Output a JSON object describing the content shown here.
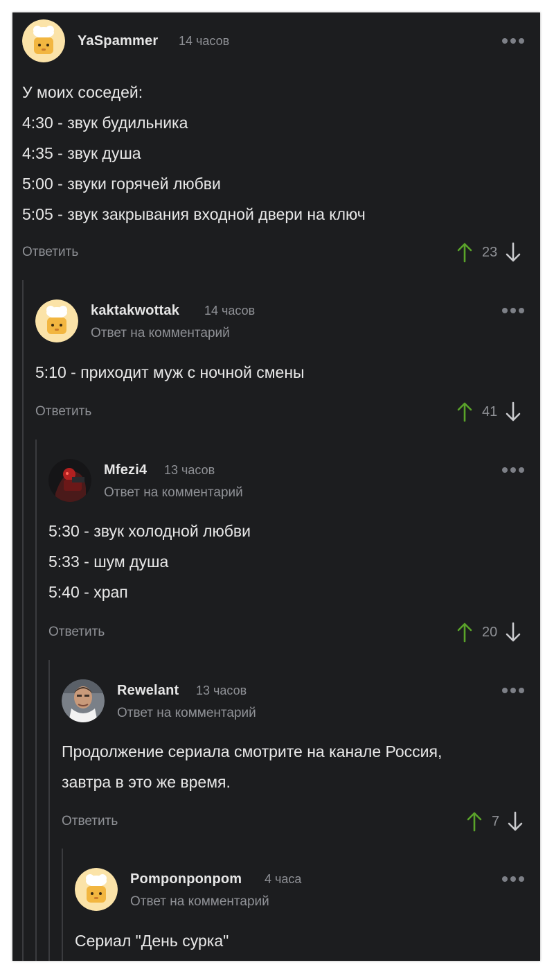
{
  "comments": [
    {
      "user": "YaSpammer",
      "time": "14 часов",
      "reply_to": "",
      "text": "У моих соседей:\n4:30 - звук будильника\n4:35 - звук душа\n5:00 - звуки горячей любви\n5:05 - звук закрывания входной двери на ключ",
      "reply_label": "Ответить",
      "rating": "23",
      "avatar": "chef-hat-cat-avatar"
    },
    {
      "user": "kaktakwottak",
      "time": "14 часов",
      "reply_to": "Ответ на комментарий",
      "text": "5:10 - приходит муж с ночной смены",
      "reply_label": "Ответить",
      "rating": "41",
      "avatar": "chef-hat-cat-avatar"
    },
    {
      "user": "Mfezi4",
      "time": "13 часов",
      "reply_to": "Ответ на комментарий",
      "text": "5:30 - звук холодной любви\n5:33 - шум душа\n5:40 - храп",
      "reply_label": "Ответить",
      "rating": "20",
      "avatar": "dark-red-figure-avatar"
    },
    {
      "user": "Rewelant",
      "time": "13 часов",
      "reply_to": "Ответ на комментарий",
      "text": "Продолжение сериала смотрите на канале Россия,\nзавтра в это же время.",
      "reply_label": "Ответить",
      "rating": "7",
      "avatar": "man-photo-avatar"
    },
    {
      "user": "Pomponponpom",
      "time": "4 часа",
      "reply_to": "Ответ на комментарий",
      "text": "Сериал \"День сурка\"",
      "avatar": "chef-hat-cat-avatar"
    }
  ],
  "colors": {
    "background": "#1c1d1f",
    "upvote": "#5aa32a",
    "muted": "#8f9196",
    "text": "#e8e8e8"
  },
  "icons": [
    "more-dots-icon",
    "upvote-arrow-icon",
    "downvote-arrow-icon"
  ]
}
